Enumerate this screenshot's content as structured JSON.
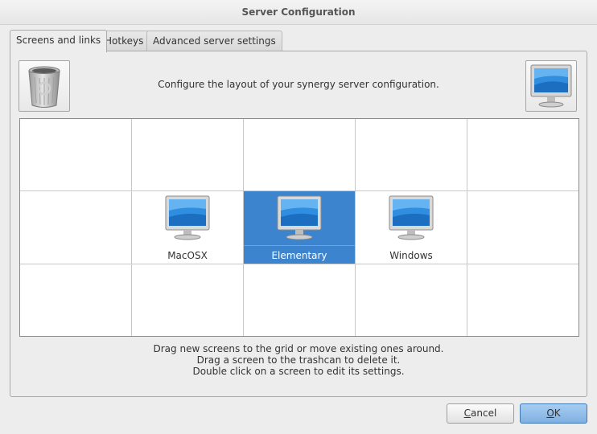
{
  "window": {
    "title": "Server Configuration"
  },
  "tabs": [
    {
      "label": "Screens and links",
      "active": true
    },
    {
      "label": "Hotkeys",
      "active": false
    },
    {
      "label": "Advanced server settings",
      "active": false
    }
  ],
  "icons": {
    "trash": "trashcan-icon",
    "new_screen": "monitor-icon"
  },
  "intro_text": "Configure the layout of your synergy server configuration.",
  "grid": {
    "rows": 3,
    "columns": 5,
    "screens": [
      {
        "name": "MacOSX",
        "row": 1,
        "col": 1,
        "selected": false
      },
      {
        "name": "Elementary",
        "row": 1,
        "col": 2,
        "selected": true
      },
      {
        "name": "Windows",
        "row": 1,
        "col": 3,
        "selected": false
      }
    ]
  },
  "help": {
    "line1": "Drag new screens to the grid or move existing ones around.",
    "line2": "Drag a screen to the trashcan to delete it.",
    "line3": "Double click on a screen to edit its settings."
  },
  "buttons": {
    "cancel": {
      "first": "C",
      "rest": "ancel"
    },
    "ok": {
      "first": "O",
      "rest": "K"
    }
  },
  "colors": {
    "selection": "#3d84cf",
    "ok_button": "#8fbde8"
  }
}
